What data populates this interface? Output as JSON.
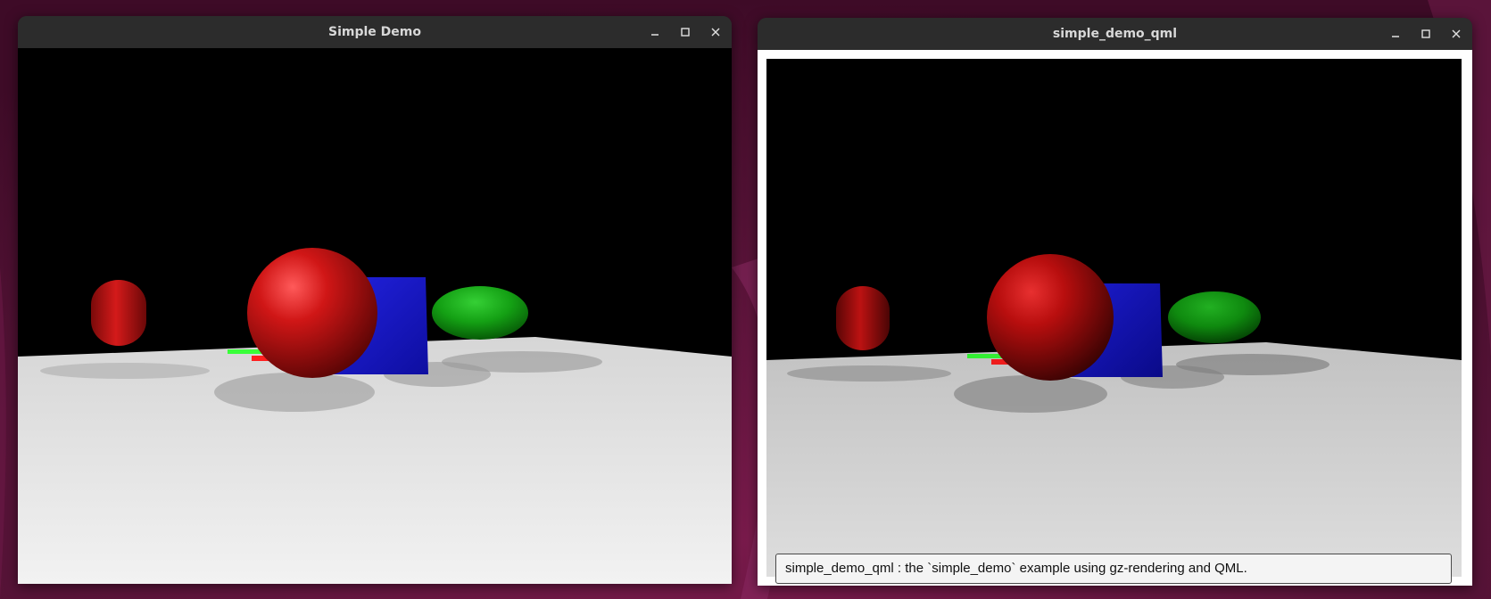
{
  "desktop": {
    "background_color": "#4a0f2e"
  },
  "windows": [
    {
      "id": "simple-demo",
      "title": "Simple Demo",
      "controls": [
        "minimize-icon",
        "maximize-icon",
        "close-icon"
      ]
    },
    {
      "id": "simple-demo-qml",
      "title": "simple_demo_qml",
      "controls": [
        "minimize-icon",
        "maximize-icon",
        "close-icon"
      ],
      "info_text": "simple_demo_qml : the `simple_demo` example using gz-rendering and QML."
    }
  ],
  "scene": {
    "sky_color": "#000000",
    "ground_color": "#e4e4e4",
    "objects": [
      {
        "name": "capsule",
        "color": "#c41414"
      },
      {
        "name": "sphere",
        "color": "#cc1111"
      },
      {
        "name": "box",
        "color": "#1a1ad0"
      },
      {
        "name": "ellipsoid",
        "color": "#12a812"
      },
      {
        "name": "axis-marker",
        "colors": [
          "#ff2222",
          "#33ff33"
        ]
      }
    ]
  }
}
